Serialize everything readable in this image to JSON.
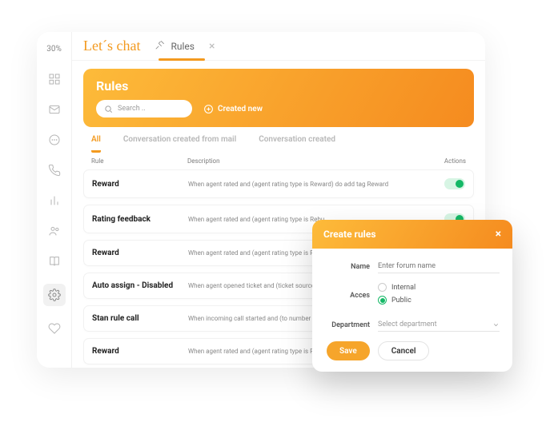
{
  "brand": "Let´s chat",
  "sidebar": {
    "pct": "30%"
  },
  "topbar": {
    "tab_label": "Rules"
  },
  "hero": {
    "title": "Rules",
    "search_placeholder": "Search ..",
    "create_label": "Created new"
  },
  "filter_tabs": {
    "all": "All",
    "mail": "Conversation created from mail",
    "created": "Conversation created"
  },
  "columns": {
    "rule": "Rule",
    "desc": "Description",
    "actions": "Actions"
  },
  "rules": [
    {
      "name": "Reward",
      "desc": "When agent rated and (agent rating type is Reward) do add tag Reward"
    },
    {
      "name": "Rating feedback",
      "desc": "When agent rated and (agent rating type is Rebu"
    },
    {
      "name": "Reward",
      "desc": "When agent rated and (agent rating type is Re"
    },
    {
      "name": "Auto assign - Disabled",
      "desc": "When agent opened ticket and (ticket source is"
    },
    {
      "name": "Stan rule call",
      "desc": "When incoming call started and (to number co"
    },
    {
      "name": "Reward",
      "desc": "When agent rated and (agent rating type is Re"
    }
  ],
  "modal": {
    "title": "Create rules",
    "labels": {
      "name": "Name",
      "access": "Acces",
      "department": "Department"
    },
    "name_placeholder": "Enter forum name",
    "access_options": {
      "internal": "Internal",
      "public": "Public"
    },
    "access_selected": "public",
    "department_placeholder": "Select department",
    "save": "Save",
    "cancel": "Cancel"
  }
}
